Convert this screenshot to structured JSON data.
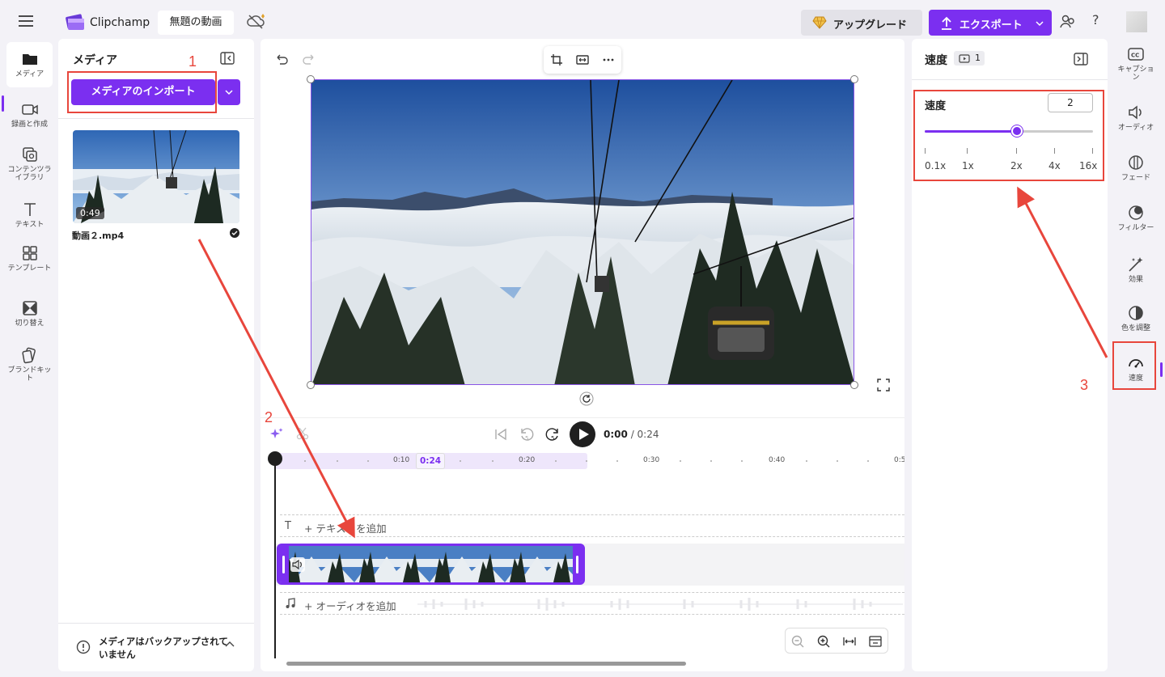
{
  "app": {
    "brand": "Clipchamp",
    "project_title": "無題の動画",
    "upgrade_label": "アップグレード",
    "export_label": "エクスポート",
    "help_label": "?",
    "accent_color": "#7b2ff0"
  },
  "left_nav": {
    "items": [
      {
        "label": "メディア",
        "icon": "folder-icon",
        "active": true
      },
      {
        "label": "録画と作成",
        "icon": "camera-icon"
      },
      {
        "label": "コンテンツライブラリ",
        "icon": "library-icon"
      },
      {
        "label": "テキスト",
        "icon": "text-icon"
      },
      {
        "label": "テンプレート",
        "icon": "template-icon"
      },
      {
        "label": "切り替え",
        "icon": "transition-icon"
      },
      {
        "label": "ブランドキット",
        "icon": "brand-kit-icon"
      }
    ]
  },
  "media_panel": {
    "title": "メディア",
    "import_label": "メディアのインポート",
    "item": {
      "duration": "0:49",
      "filename": "動画２.mp4"
    },
    "backup_text": "メディアはバックアップされていません"
  },
  "player": {
    "current_time": "0:00",
    "total_time": "/ 0:24"
  },
  "timeline": {
    "ticks": [
      "0:10",
      "0:20",
      "0:30",
      "0:40",
      "0:5"
    ],
    "current_marker": "0:24",
    "add_text": "+ テキストを追加",
    "add_audio": "+ オーディオを追加"
  },
  "speed_panel": {
    "title": "速度",
    "badge_count": "1",
    "label": "速度",
    "value": "2",
    "slider_fraction": 0.55,
    "scale_labels": [
      "0.1x",
      "1x",
      "2x",
      "4x",
      "16x"
    ]
  },
  "right_nav": {
    "items": [
      {
        "label": "キャプション",
        "icon": "captions-icon"
      },
      {
        "label": "オーディオ",
        "icon": "audio-icon"
      },
      {
        "label": "フェード",
        "icon": "fade-icon"
      },
      {
        "label": "フィルター",
        "icon": "filter-icon"
      },
      {
        "label": "効果",
        "icon": "effects-icon"
      },
      {
        "label": "色を調整",
        "icon": "color-adjust-icon"
      },
      {
        "label": "速度",
        "icon": "speed-icon",
        "active": true
      }
    ]
  },
  "annotations": {
    "labels": [
      "1",
      "2",
      "3"
    ],
    "color": "#e8463c"
  }
}
